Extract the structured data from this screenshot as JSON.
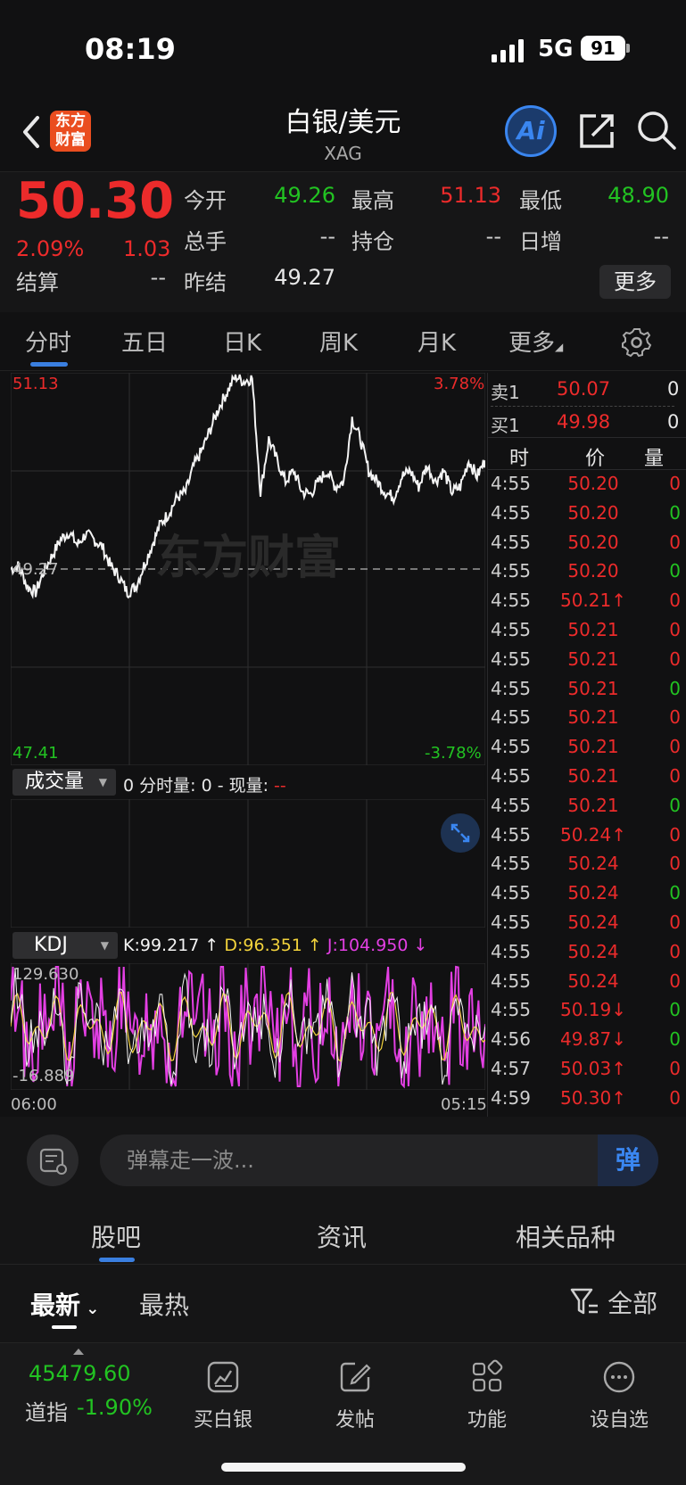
{
  "status_bar": {
    "time": "08:19",
    "network": "5G",
    "battery": "91"
  },
  "header": {
    "logo_text_line1": "东方",
    "logo_text_line2": "财富",
    "title": "白银/美元",
    "subtitle": "XAG",
    "ai_label": "Ai"
  },
  "quote": {
    "price": "50.30",
    "change_pct": "2.09%",
    "change_abs": "1.03",
    "fields": [
      {
        "label": "今开",
        "value": "49.26",
        "color": "#22c322"
      },
      {
        "label": "最高",
        "value": "51.13",
        "color": "#ec2b2b"
      },
      {
        "label": "最低",
        "value": "48.90",
        "color": "#22c322"
      },
      {
        "label": "总手",
        "value": "--",
        "color": "#cfcfcf"
      },
      {
        "label": "持仓",
        "value": "--",
        "color": "#cfcfcf"
      },
      {
        "label": "日增",
        "value": "--",
        "color": "#cfcfcf"
      },
      {
        "label": "结算",
        "value": "--",
        "color": "#cfcfcf"
      },
      {
        "label": "昨结",
        "value": "49.27",
        "color": "#e8e8e8"
      }
    ],
    "more_label": "更多"
  },
  "chart_tabs": [
    "分时",
    "五日",
    "日K",
    "周K",
    "月K",
    "更多"
  ],
  "chart": {
    "price_high": "51.13",
    "price_low": "47.41",
    "pct_high": "3.78%",
    "pct_low": "-3.78%",
    "prev_close_label": "49.27",
    "watermark": "东方财富",
    "volume_dropdown": "成交量",
    "volume_info_prefix": "0 分时量: 0 - 现量: ",
    "volume_info_suffix": "--",
    "kdj_dropdown": "KDJ",
    "kdj_k": "K:99.217 ↑",
    "kdj_d": "D:96.351 ↑",
    "kdj_j": "J:104.950 ↓",
    "kdj_max": "129.630",
    "kdj_min": "-16.889",
    "time_start": "06:00",
    "time_end": "05:15"
  },
  "chart_data": {
    "type": "line",
    "ylim": [
      47.41,
      51.13
    ],
    "prev_close": 49.27,
    "x_start": "06:00",
    "x_end": "05:15",
    "price_series": [
      49.27,
      49.3,
      49.1,
      49.05,
      49.25,
      49.4,
      49.55,
      49.62,
      49.5,
      49.6,
      49.55,
      49.48,
      49.3,
      49.2,
      49.05,
      49.1,
      49.3,
      49.5,
      49.7,
      49.8,
      49.95,
      50.0,
      50.25,
      50.4,
      50.6,
      50.8,
      50.95,
      51.1,
      51.05,
      51.08,
      50.0,
      50.5,
      50.3,
      50.1,
      50.2,
      50.0,
      49.98,
      50.1,
      50.2,
      50.05,
      50.1,
      50.7,
      50.5,
      50.2,
      50.1,
      50.0,
      49.95,
      50.15,
      50.2,
      50.05,
      50.25,
      50.1,
      50.2,
      50.0,
      50.05,
      50.3,
      50.15,
      50.3
    ]
  },
  "order_book": {
    "sell_label": "卖1",
    "sell_price": "50.07",
    "sell_vol": "0",
    "buy_label": "买1",
    "buy_price": "49.98",
    "buy_vol": "0",
    "col_time": "时",
    "col_price": "价",
    "col_vol": "量"
  },
  "ticks": [
    {
      "t": "4:55",
      "p": "50.20",
      "v": "0",
      "vc": "red"
    },
    {
      "t": "4:55",
      "p": "50.20",
      "v": "0",
      "vc": "green"
    },
    {
      "t": "4:55",
      "p": "50.20",
      "v": "0",
      "vc": "red"
    },
    {
      "t": "4:55",
      "p": "50.20",
      "v": "0",
      "vc": "green"
    },
    {
      "t": "4:55",
      "p": "50.21↑",
      "v": "0",
      "vc": "red"
    },
    {
      "t": "4:55",
      "p": "50.21",
      "v": "0",
      "vc": "red"
    },
    {
      "t": "4:55",
      "p": "50.21",
      "v": "0",
      "vc": "red"
    },
    {
      "t": "4:55",
      "p": "50.21",
      "v": "0",
      "vc": "green"
    },
    {
      "t": "4:55",
      "p": "50.21",
      "v": "0",
      "vc": "red"
    },
    {
      "t": "4:55",
      "p": "50.21",
      "v": "0",
      "vc": "red"
    },
    {
      "t": "4:55",
      "p": "50.21",
      "v": "0",
      "vc": "red"
    },
    {
      "t": "4:55",
      "p": "50.21",
      "v": "0",
      "vc": "green"
    },
    {
      "t": "4:55",
      "p": "50.24↑",
      "v": "0",
      "vc": "red"
    },
    {
      "t": "4:55",
      "p": "50.24",
      "v": "0",
      "vc": "red"
    },
    {
      "t": "4:55",
      "p": "50.24",
      "v": "0",
      "vc": "green"
    },
    {
      "t": "4:55",
      "p": "50.24",
      "v": "0",
      "vc": "red"
    },
    {
      "t": "4:55",
      "p": "50.24",
      "v": "0",
      "vc": "red"
    },
    {
      "t": "4:55",
      "p": "50.24",
      "v": "0",
      "vc": "red"
    },
    {
      "t": "4:55",
      "p": "50.19↓",
      "v": "0",
      "vc": "green"
    },
    {
      "t": "4:56",
      "p": "49.87↓",
      "v": "0",
      "vc": "green"
    },
    {
      "t": "4:57",
      "p": "50.03↑",
      "v": "0",
      "vc": "red"
    },
    {
      "t": "4:59",
      "p": "50.30↑",
      "v": "0",
      "vc": "red"
    }
  ],
  "comment": {
    "placeholder": "弹幕走一波...",
    "danmu_label": "弹"
  },
  "section_tabs": [
    "股吧",
    "资讯",
    "相关品种"
  ],
  "sort": {
    "latest": "最新",
    "hottest": "最热",
    "filter": "全部"
  },
  "bottom_nav": {
    "index_value": "45479.60",
    "index_name": "道指",
    "index_change": "-1.90%",
    "items": [
      "买白银",
      "发帖",
      "功能",
      "设自选"
    ]
  }
}
